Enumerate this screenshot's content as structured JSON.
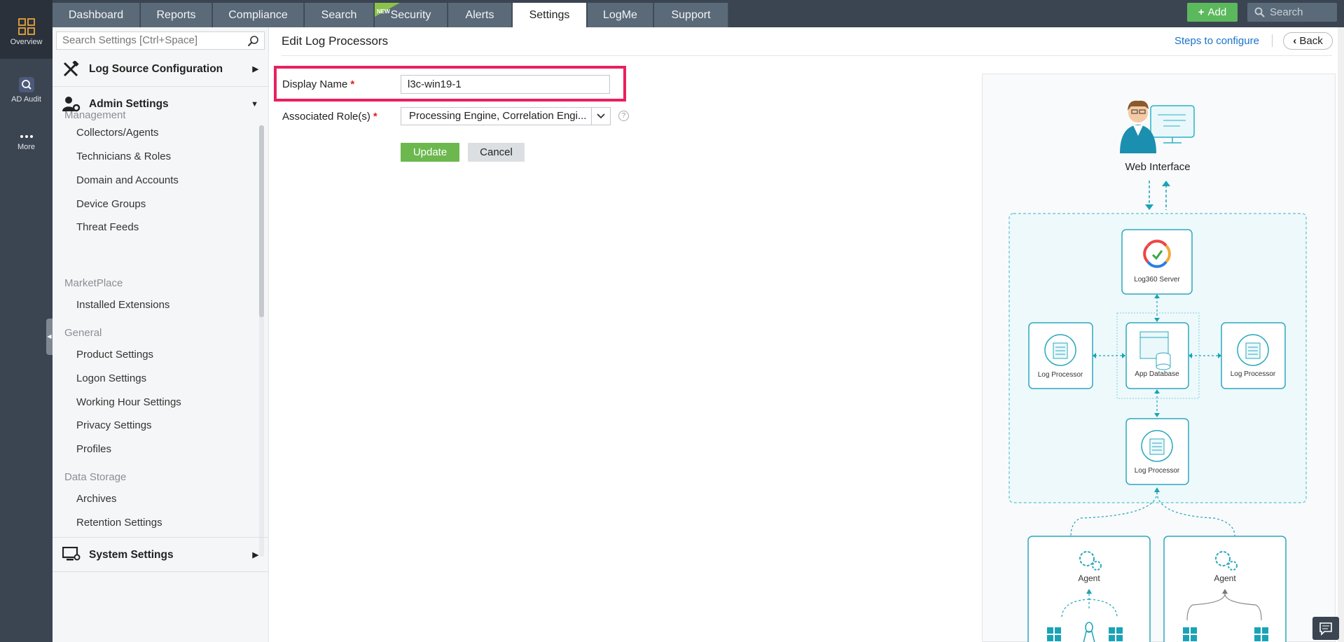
{
  "rail": {
    "overview": "Overview",
    "ad_audit": "AD Audit",
    "more": "More"
  },
  "tabs": [
    {
      "label": "Dashboard"
    },
    {
      "label": "Reports"
    },
    {
      "label": "Compliance"
    },
    {
      "label": "Search"
    },
    {
      "label": "Security",
      "badge": "NEW"
    },
    {
      "label": "Alerts"
    },
    {
      "label": "Settings",
      "active": true
    },
    {
      "label": "LogMe"
    },
    {
      "label": "Support"
    }
  ],
  "topbar": {
    "add_label": "Add",
    "search_placeholder": "Search"
  },
  "sidebar": {
    "search_placeholder": "Search Settings [Ctrl+Space]",
    "log_source": "Log Source Configuration",
    "admin": "Admin Settings",
    "system": "System Settings",
    "groups": {
      "management": "Management",
      "marketplace": "MarketPlace",
      "general": "General",
      "data_storage": "Data Storage"
    },
    "items": {
      "collectors": "Collectors/Agents",
      "technicians": "Technicians & Roles",
      "domain": "Domain and Accounts",
      "device_groups": "Device Groups",
      "threat_feeds": "Threat Feeds",
      "installed_ext": "Installed Extensions",
      "product_settings": "Product Settings",
      "logon_settings": "Logon Settings",
      "working_hour": "Working Hour Settings",
      "privacy": "Privacy Settings",
      "profiles": "Profiles",
      "archives": "Archives",
      "retention": "Retention Settings"
    }
  },
  "main": {
    "title": "Edit Log Processors",
    "steps_link": "Steps to configure",
    "back": "Back",
    "display_name_label": "Display Name",
    "display_name_value": "l3c-win19-1",
    "roles_label": "Associated Role(s)",
    "roles_value": "Processing Engine, Correlation Engi...",
    "required_mark": "*",
    "help": "?",
    "update": "Update",
    "cancel": "Cancel"
  },
  "diagram": {
    "web_interface": "Web Interface",
    "server": "Log360 Server",
    "log_processor": "Log Processor",
    "app_database": "App Database",
    "agent": "Agent"
  },
  "colors": {
    "accent_teal": "#1aa3b8",
    "highlight": "#ea1f5f",
    "update_green": "#6cb84f",
    "add_green": "#5cb85c",
    "dark_nav": "#3b4451"
  }
}
